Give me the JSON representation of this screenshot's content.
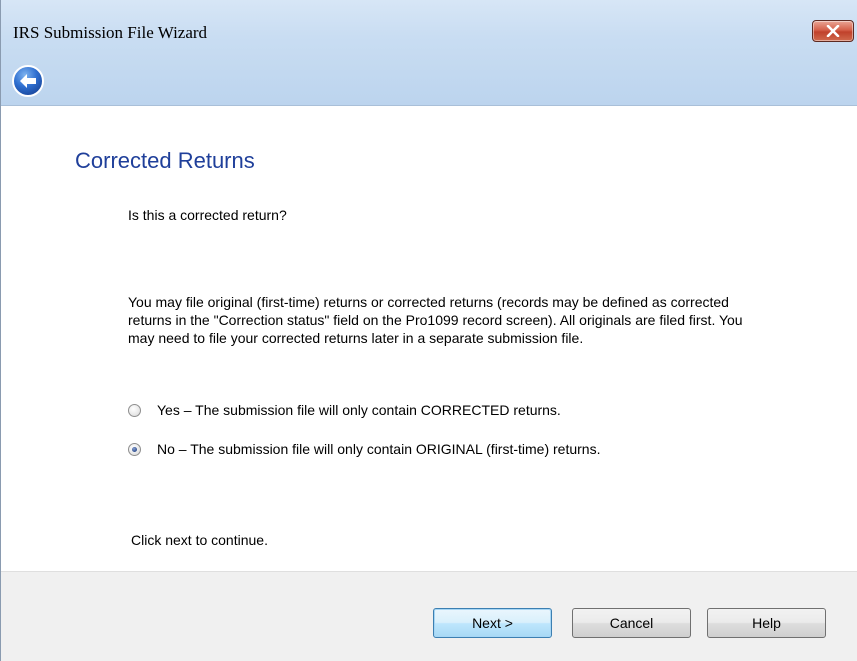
{
  "window": {
    "title": "IRS Submission File Wizard"
  },
  "page": {
    "title": "Corrected Returns",
    "question": "Is this a corrected return?",
    "description": "You may file original (first-time) returns or corrected returns (records may be defined as corrected returns in the \"Correction status\" field on the Pro1099 record screen). All originals are filed first. You may need to file your corrected returns later in a separate submission file.",
    "options": [
      {
        "label": "Yes – The submission file will only contain CORRECTED returns.",
        "selected": false
      },
      {
        "label": "No – The submission file will only contain ORIGINAL (first-time) returns.",
        "selected": true
      }
    ],
    "footer": "Click next to continue."
  },
  "buttons": {
    "next": "Next >",
    "cancel": "Cancel",
    "help": "Help"
  },
  "icons": {
    "back": "back-arrow-icon",
    "close": "close-icon"
  },
  "colors": {
    "title_accent": "#1f3f9a",
    "back_icon": "#2f6fd0",
    "close_button": "#c9452e"
  }
}
